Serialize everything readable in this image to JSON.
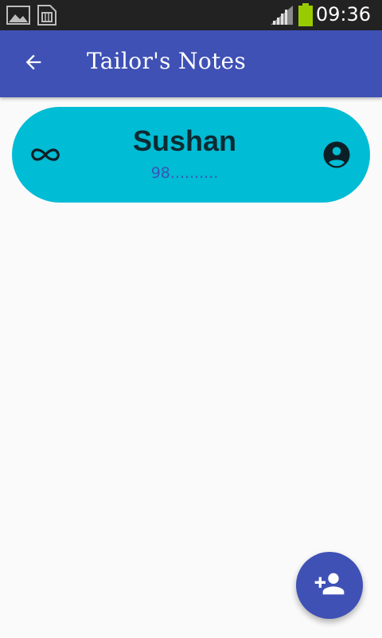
{
  "status_bar": {
    "time": "09:36",
    "icons": [
      "image-notification-icon",
      "sim-card-icon",
      "signal-icon",
      "battery-icon"
    ]
  },
  "app_bar": {
    "title": "Tailor's Notes",
    "back_icon": "arrow-back-icon",
    "color": "#3f51b5"
  },
  "customers": [
    {
      "name": "Sushan",
      "phone": "98..........",
      "left_icon": "infinity-link-icon",
      "right_icon": "account-circle-icon",
      "card_color": "#00bcd4"
    }
  ],
  "fab": {
    "icon": "person-add-icon",
    "color": "#3f51b5"
  }
}
